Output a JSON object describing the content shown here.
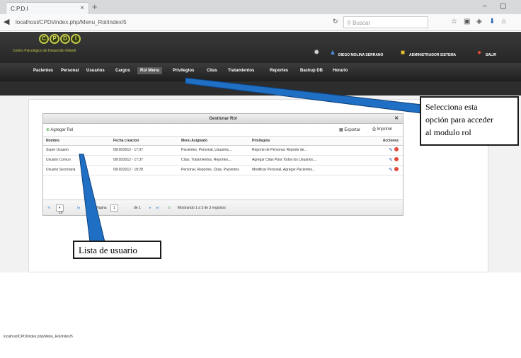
{
  "browser": {
    "tab_title": "C.P.D.I",
    "close_glyph": "×",
    "new_tab_glyph": "+",
    "win_min": "–",
    "win_max": "▢",
    "url": "localhost/CPDI/index.php/Menu_Rol/index/5",
    "search_placeholder": "Buscar",
    "status_url": "localhost/CPDI/index.php/Menu_Rol/index/5"
  },
  "app": {
    "logo_letters": [
      "C",
      "P",
      "D",
      "I"
    ],
    "logo_text": "Centro Psicológico de Desarrollo Infantil",
    "user_name": "DIEGO MOLINA SERRANO",
    "role_name": "ADMINISTRADOR SISTEMA",
    "logout": "SALIR"
  },
  "menu": [
    "Pacientes",
    "Personal",
    "Usuarios",
    "Cargos",
    "Rol Menu",
    "Privilegios",
    "Citas",
    "Tratamientos",
    "Reportes",
    "Backup DB",
    "Horario"
  ],
  "grid": {
    "title": "Gestionar Rol",
    "add_label": "Agregar Rol",
    "export_label": "Exportar",
    "print_label": "Imprimir",
    "columns": [
      "Nombre",
      "Fecha creacion",
      "Menu Asignado",
      "Privilegios",
      "Acciones"
    ],
    "rows": [
      [
        "Super Usuario",
        "09/10/2012 - 17:37",
        "Pacientes, Personal, Usuarios,...",
        "Reporte de Personal, Reporte de..."
      ],
      [
        "Usuario Comun",
        "09/10/2012 - 17:37",
        "Citas, Tratamientos, Reportes,...",
        "Agregar Citas Para Todos los Usuarios,..."
      ],
      [
        "Usuario Secretaria",
        "09/10/2012 - 18:28",
        "Personal, Reportes, Citas, Pacientes",
        "Modificar Personal, Agregar Pacientes..."
      ]
    ],
    "pager": {
      "page_size": "10",
      "page_label": "Página",
      "page_value": "1",
      "of_label": "de 1",
      "summary": "Mostrando 1 a 3 de 3 registros"
    }
  },
  "callouts": {
    "right": [
      "Selecciona esta",
      "opción para acceder",
      "al modulo rol"
    ],
    "left": "Lista de usuario"
  },
  "colors": {
    "callout_arrow": "#1f6fc4",
    "header_bg": "#2a2a2a",
    "accent_logo": "#c5c94a",
    "delete_icon": "#e0493b",
    "edit_icon": "#2b65b4"
  }
}
